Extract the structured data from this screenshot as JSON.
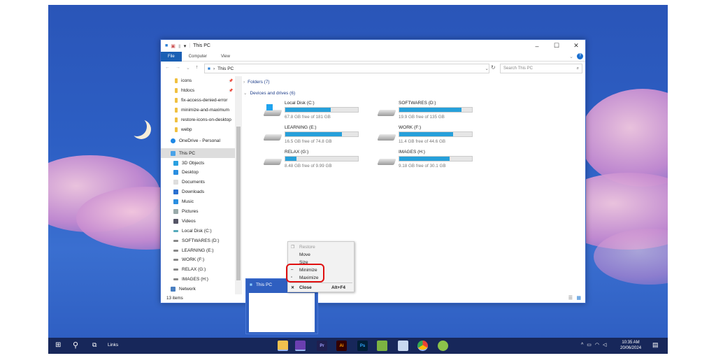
{
  "window": {
    "title": "This PC",
    "ribbon_tabs": [
      "File",
      "Computer",
      "View"
    ],
    "address": "This PC",
    "search_placeholder": "Search This PC",
    "status": "13 items"
  },
  "nav": {
    "quick": [
      "icons",
      "htdocs",
      "fix-access-denied-error",
      "minimize-and-maximum",
      "restore-icons-on-desktop",
      "webp"
    ],
    "onedrive": "OneDrive - Personal",
    "this_pc": "This PC",
    "pc_items": [
      "3D Objects",
      "Desktop",
      "Documents",
      "Downloads",
      "Music",
      "Pictures",
      "Videos",
      "Local Disk (C:)",
      "SOFTWARES (D:)",
      "LEARNING (E:)",
      "WORK (F:)",
      "RELAX (G:)",
      "IMAGES (H:)"
    ],
    "network": "Network"
  },
  "groups": {
    "folders": "Folders (7)",
    "drives": "Devices and drives (6)"
  },
  "drives": [
    {
      "name": "Local Disk (C:)",
      "free": "67.8 GB free of 181 GB",
      "used": 0.625
    },
    {
      "name": "SOFTWARES (D:)",
      "free": "19.9 GB free of 135 GB",
      "used": 0.853
    },
    {
      "name": "LEARNING (E:)",
      "free": "16.5 GB free of 74.8 GB",
      "used": 0.78
    },
    {
      "name": "WORK (F:)",
      "free": "11.4 GB free of 44.6 GB",
      "used": 0.744
    },
    {
      "name": "RELAX (G:)",
      "free": "8.48 GB free of 9.99 GB",
      "used": 0.151
    },
    {
      "name": "IMAGES (H:)",
      "free": "9.18 GB free of 30.1 GB",
      "used": 0.695
    }
  ],
  "menu": {
    "restore": "Restore",
    "move": "Move",
    "size": "Size",
    "minimize": "Minimize",
    "maximize": "Maximize",
    "close": "Close",
    "close_shortcut": "Alt+F4"
  },
  "thumb": {
    "title": "This PC"
  },
  "taskbar": {
    "links": "Links",
    "time": "10:35 AM",
    "date": "20/06/2024",
    "apps": [
      "Pr",
      "Ai",
      "Ps"
    ]
  },
  "colors": {
    "accent": "#1a5fb4",
    "bar": "#26a0da",
    "highlight": "#e01010"
  }
}
